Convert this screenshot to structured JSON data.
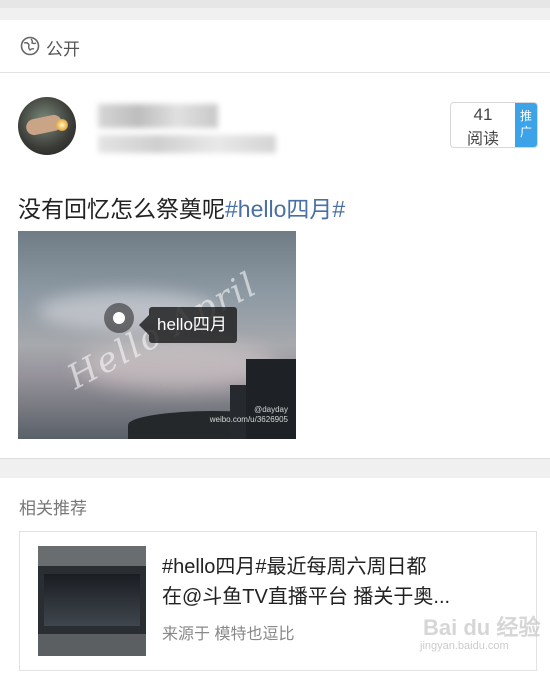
{
  "visibility": {
    "icon": "globe-icon",
    "label": "公开"
  },
  "post": {
    "avatar": "avatar",
    "stats": {
      "count": "41",
      "count_label": "阅读",
      "promo_label": "推广"
    },
    "text": "没有回忆怎么祭奠呢",
    "hashtag": "#hello四月#",
    "image": {
      "script_text": "Hello April",
      "tag_label": "hello四月",
      "watermark_line1": "@dayday",
      "watermark_line2": "weibo.com/u/3626905"
    }
  },
  "recommend": {
    "heading": "相关推荐",
    "items": [
      {
        "title_line1": "#hello四月#最近每周六周日都",
        "title_line2": "在@斗鱼TV直播平台 播关于奥...",
        "source_prefix": "来源于",
        "source_name": "模特也逗比"
      }
    ]
  },
  "watermark": {
    "brand": "Bai du 经验",
    "url": "jingyan.baidu.com"
  },
  "colors": {
    "hashtag": "#4a6fa5",
    "promo": "#3da3e8"
  }
}
